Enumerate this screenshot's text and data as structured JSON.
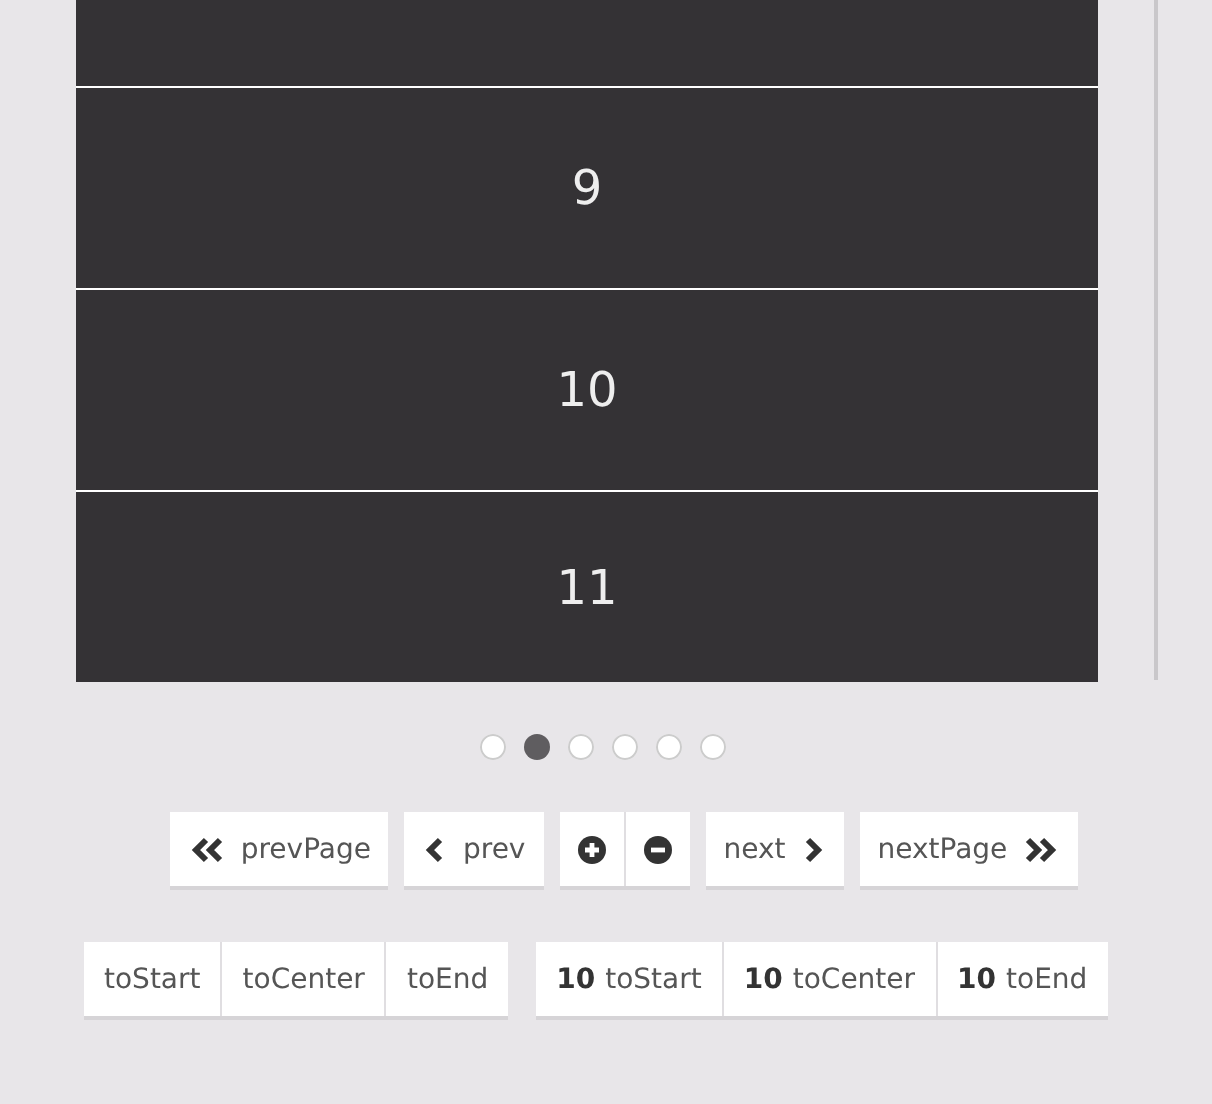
{
  "slides": [
    {
      "kind": "cut"
    },
    {
      "kind": "full",
      "label": "9"
    },
    {
      "kind": "full",
      "label": "10"
    },
    {
      "kind": "full",
      "label": "11"
    }
  ],
  "pagination": [
    {
      "selected": false
    },
    {
      "selected": true
    },
    {
      "selected": false
    },
    {
      "selected": false
    },
    {
      "selected": false
    },
    {
      "selected": false
    }
  ],
  "navigation_rows": [
    {
      "groups": [
        {
          "buttons": [
            {
              "kind": "prev-page",
              "label": "prevPage"
            }
          ]
        },
        {
          "buttons": [
            {
              "kind": "prev",
              "label": "prev"
            }
          ]
        },
        {
          "buttons": [
            {
              "kind": "zoom-in"
            },
            {
              "kind": "zoom-out"
            }
          ]
        },
        {
          "buttons": [
            {
              "kind": "next",
              "label": "next"
            }
          ]
        },
        {
          "buttons": [
            {
              "kind": "next-page",
              "label": "nextPage"
            }
          ]
        }
      ]
    },
    {
      "groups": [
        {
          "buttons": [
            {
              "kind": "plain",
              "label": "toStart"
            },
            {
              "kind": "plain",
              "label": "toCenter"
            },
            {
              "kind": "plain",
              "label": "toEnd"
            }
          ]
        },
        {
          "buttons": [
            {
              "kind": "indexed",
              "index": "10",
              "label": "toStart"
            },
            {
              "kind": "indexed",
              "index": "10",
              "label": "toCenter"
            },
            {
              "kind": "indexed",
              "index": "10",
              "label": "toEnd"
            }
          ]
        }
      ]
    }
  ]
}
